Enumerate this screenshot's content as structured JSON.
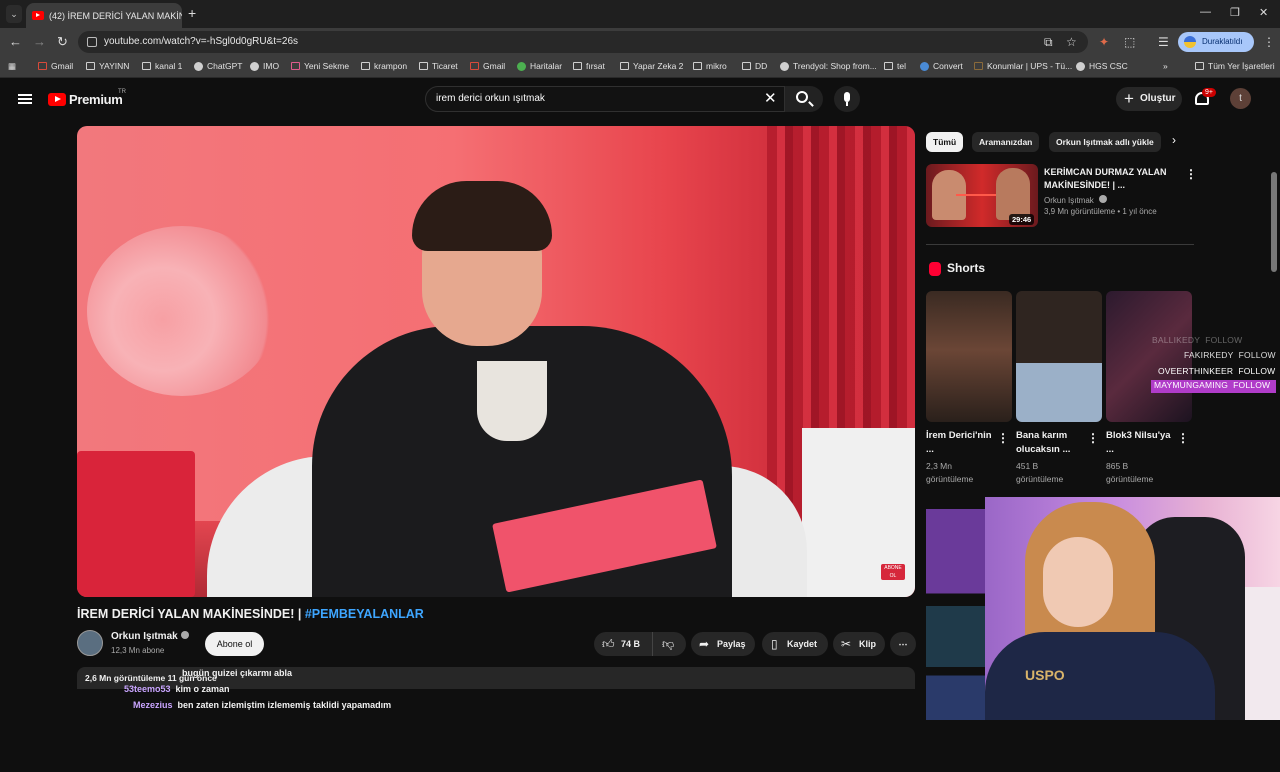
{
  "browser": {
    "tab_title": "(42) İREM DERİCİ YALAN MAKİN",
    "url": "youtube.com/watch?v=-hSgl0d0gRU&t=26s",
    "profile_label": "Duraklatıldı",
    "bookmarks": [
      "Gmail",
      "YAYINN",
      "kanal 1",
      "ChatGPT",
      "IMO",
      "Yeni Sekme",
      "krampon",
      "Ticaret",
      "Gmail",
      "Haritalar",
      "fırsat",
      "Yapar Zeka 2",
      "mikro",
      "DD",
      "Trendyol: Shop from...",
      "tel",
      "Convert",
      "Konumlar | UPS - Tü...",
      "HGS CSC"
    ],
    "all_bookmarks": "Tüm Yer İşaretleri",
    "bookmarks_more": "»"
  },
  "youtube": {
    "logo": "Premium",
    "logo_region": "TR",
    "search_value": "irem derici orkun ışıtmak",
    "create_label": "Oluştur",
    "notif_count": "9+",
    "avatar_letter": "t"
  },
  "video": {
    "title": "İREM DERİCİ YALAN MAKİNESİNDE! | ",
    "hashtag": "#PEMBEYALANLAR",
    "channel": "Orkun Işıtmak",
    "subscribers": "12,3 Mn abone",
    "subscribe_label": "Abone ol",
    "likes": "74 B",
    "share_label": "Paylaş",
    "save_label": "Kaydet",
    "clip_label": "Klip",
    "views_date": "2,6 Mn görüntüleme  11 gün önce",
    "overlay_badge": "ABONE OL"
  },
  "chips": [
    "Tümü",
    "Aramanızdan",
    "Orkun Işıtmak adlı yükle"
  ],
  "related": {
    "title": "KERİMCAN DURMAZ YALAN MAKİNESİNDE! | ...",
    "channel": "Orkun Işıtmak",
    "meta": "3,9 Mn görüntüleme • 1 yıl önce",
    "duration": "29:46"
  },
  "shorts": {
    "heading": "Shorts",
    "items": [
      {
        "title": "İrem Derici'nin ...",
        "views": "2,3 Mn",
        "views_label": "görüntüleme"
      },
      {
        "title": "Bana karım olucaksın ...",
        "views": "451 B",
        "views_label": "görüntüleme"
      },
      {
        "title": "Blok3 Nilsu'ya ...",
        "views": "865 B",
        "views_label": "görüntüleme"
      }
    ]
  },
  "follow_overlay": [
    {
      "name": "BALLIKEDY",
      "label": "FOLLOW"
    },
    {
      "name": "FAKIRKEDY",
      "label": "FOLLOW"
    },
    {
      "name": "OVEERTHINKEER",
      "label": "FOLLOW"
    },
    {
      "name": "MAYMUNGAMING",
      "label": "FOLLOW"
    }
  ],
  "chat": [
    {
      "user": "",
      "message": "bugün quizei çıkarmı abla"
    },
    {
      "user": "53teemo53",
      "message": "kim o zaman"
    },
    {
      "user": "Mezezius",
      "message": "ben zaten izlemiştim izlememiş taklidi yapamadım"
    }
  ],
  "webcam_shirt_text": "USPO",
  "colors": {
    "accent": "#ff0000",
    "link": "#3ea6ff",
    "follow_highlight": "#b03cc9",
    "chat_user": "#c9a5ff"
  }
}
